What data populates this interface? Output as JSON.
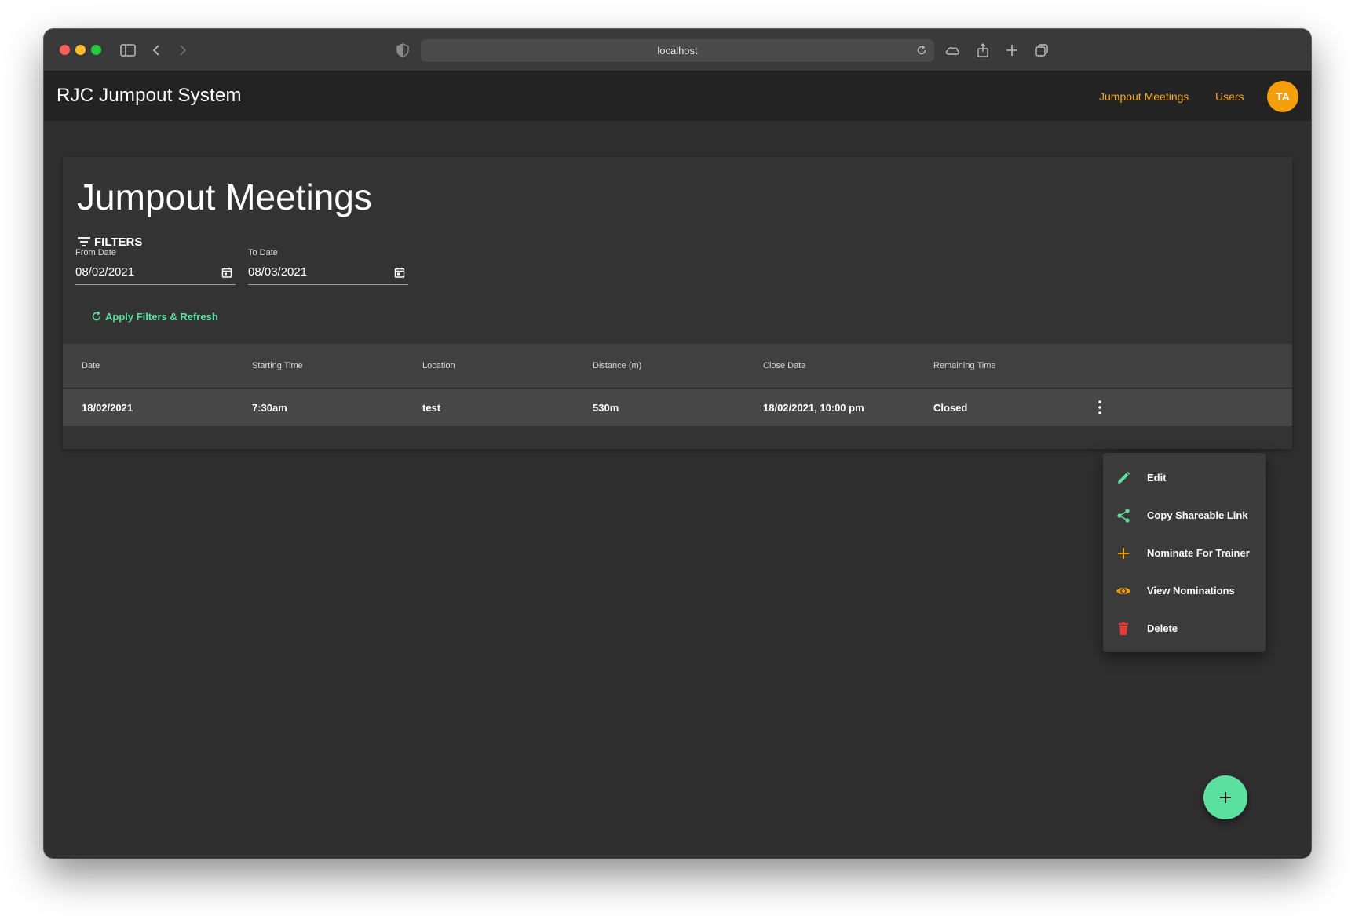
{
  "browser": {
    "url": "localhost"
  },
  "header": {
    "app_title": "RJC Jumpout System",
    "nav": [
      {
        "label": "Jumpout Meetings"
      },
      {
        "label": "Users"
      }
    ],
    "avatar_initials": "TA"
  },
  "page": {
    "title": "Jumpout Meetings",
    "filters": {
      "heading": "FILTERS",
      "from_label": "From Date",
      "from_value": "08/02/2021",
      "to_label": "To Date",
      "to_value": "08/03/2021",
      "apply_label": "Apply Filters & Refresh"
    }
  },
  "table": {
    "columns": [
      "Date",
      "Starting Time",
      "Location",
      "Distance (m)",
      "Close Date",
      "Remaining Time"
    ],
    "rows": [
      {
        "date": "18/02/2021",
        "start": "7:30am",
        "location": "test",
        "distance": "530m",
        "close": "18/02/2021, 10:00 pm",
        "remaining": "Closed"
      }
    ]
  },
  "menu": {
    "items": [
      {
        "label": "Edit",
        "icon": "pencil-icon",
        "color": "#5ce0a0"
      },
      {
        "label": "Copy Shareable Link",
        "icon": "share-icon",
        "color": "#5ce0a0"
      },
      {
        "label": "Nominate For Trainer",
        "icon": "plus-icon",
        "color": "#f59e0b"
      },
      {
        "label": "View Nominations",
        "icon": "eye-icon",
        "color": "#f59e0b"
      },
      {
        "label": "Delete",
        "icon": "trash-icon",
        "color": "#e53935"
      }
    ]
  },
  "colors": {
    "accent_orange": "#f5a623",
    "accent_green": "#5ce0a0",
    "danger_red": "#e53935"
  }
}
